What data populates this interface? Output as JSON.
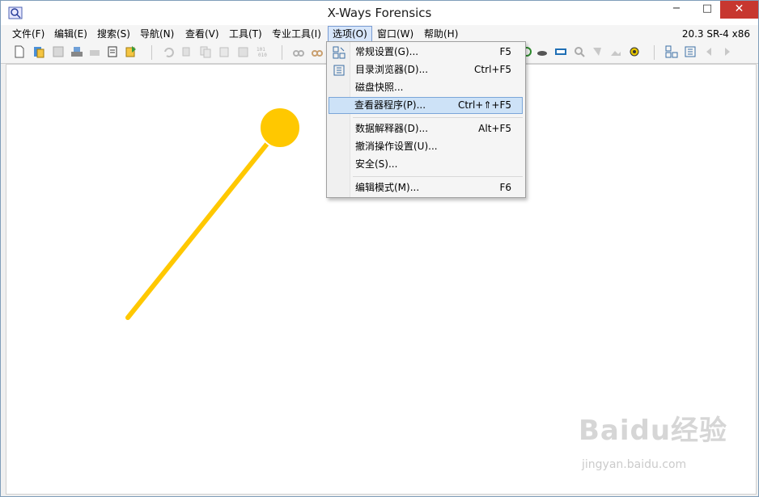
{
  "window": {
    "title": "X-Ways Forensics",
    "version": "20.3 SR-4 x86"
  },
  "window_controls": {
    "minimize": "−",
    "maximize": "□",
    "close": "✕"
  },
  "menubar": {
    "items": [
      {
        "label": "文件(F)"
      },
      {
        "label": "编辑(E)"
      },
      {
        "label": "搜索(S)"
      },
      {
        "label": "导航(N)"
      },
      {
        "label": "查看(V)"
      },
      {
        "label": "工具(T)"
      },
      {
        "label": "专业工具(I)"
      },
      {
        "label": "选项(O)"
      },
      {
        "label": "窗口(W)"
      },
      {
        "label": "帮助(H)"
      }
    ],
    "active": "选项(O)"
  },
  "options_menu": {
    "items": [
      {
        "label": "常规设置(G)...",
        "shortcut": "F5",
        "icon": "general-settings-icon"
      },
      {
        "label": "目录浏览器(D)...",
        "shortcut": "Ctrl+F5",
        "icon": "directory-browser-icon"
      },
      {
        "label": "磁盘快照...",
        "shortcut": ""
      },
      {
        "label": "查看器程序(P)...",
        "shortcut": "Ctrl+⇑+F5",
        "highlighted": true
      },
      {
        "label": "数据解释器(D)...",
        "shortcut": "Alt+F5"
      },
      {
        "label": "撤消操作设置(U)...",
        "shortcut": ""
      },
      {
        "label": "安全(S)...",
        "shortcut": ""
      },
      {
        "label": "编辑模式(M)...",
        "shortcut": "F6"
      }
    ]
  },
  "watermark": {
    "main": "Baidu经验",
    "sub": "jingyan.baidu.com"
  },
  "colors": {
    "accent": "#ffc800",
    "highlight": "#cde2f7",
    "close": "#c7372f"
  }
}
